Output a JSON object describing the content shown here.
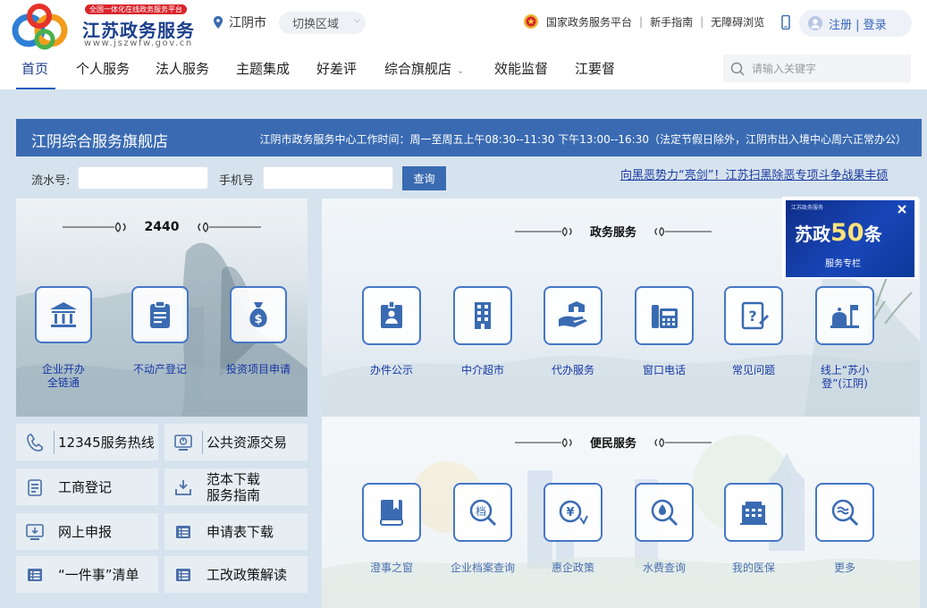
{
  "header": {
    "logo_badge": "全国一体化在线政务服务平台",
    "logo_title": "江苏政务服务",
    "logo_url": "www.jszwfw.gov.cn",
    "city": "江阴市",
    "switch_area": "切换区域",
    "top_links": [
      "国家政务服务平台",
      "新手指南",
      "无障碍浏览"
    ],
    "login": "注册 | 登录"
  },
  "nav": {
    "items": [
      "首页",
      "个人服务",
      "法人服务",
      "主题集成",
      "好差评",
      "综合旗舰店",
      "效能监督",
      "江要督"
    ],
    "search_placeholder": "请输入关键字"
  },
  "banner": {
    "title": "江阴综合服务旗舰店",
    "hours": "江阴市政务服务中心工作时间：周一至周五上午08:30--11:30 下午13:00--16:30（法定节假日除外，江阴市出入境中心周六正常办公）"
  },
  "query": {
    "serial_label": "流水号:",
    "phone_label": "手机号",
    "button": "查询",
    "promo_link": "向黑恶势力“亮剑”！江苏扫黑除恶专项斗争战果丰硕"
  },
  "left_panel": {
    "count": "2440",
    "services": [
      {
        "label": "企业开办\n全链通",
        "icon": "bank-icon"
      },
      {
        "label": "不动产登记",
        "icon": "clipboard-icon"
      },
      {
        "label": "投资项目申请",
        "icon": "money-bag-icon"
      }
    ]
  },
  "quick_links": [
    "12345服务热线",
    "公共资源交易",
    "工商登记",
    "范本下载\n服务指南",
    "网上申报",
    "申请表下载",
    "“一件事”清单",
    "工改政策解读"
  ],
  "gov_services": {
    "title": "政务服务",
    "items": [
      "办件公示",
      "中介超市",
      "代办服务",
      "窗口电话",
      "常见问题",
      "线上“苏小\n登”(江阴)"
    ]
  },
  "people_services": {
    "title": "便民服务",
    "items": [
      "澄事之窗",
      "企业档案查询",
      "惠企政策",
      "水费查询",
      "我的医保",
      "更多"
    ]
  },
  "popup": {
    "head": "江苏政务服务",
    "title_prefix": "苏政",
    "title_number": "50",
    "title_suffix": "条",
    "sub": "服务专栏"
  },
  "colors": {
    "brand_blue": "#3a6bb2",
    "nav_underline": "#1f5bbd",
    "icon_border": "#4577c6",
    "link_blue": "#1637a6"
  }
}
